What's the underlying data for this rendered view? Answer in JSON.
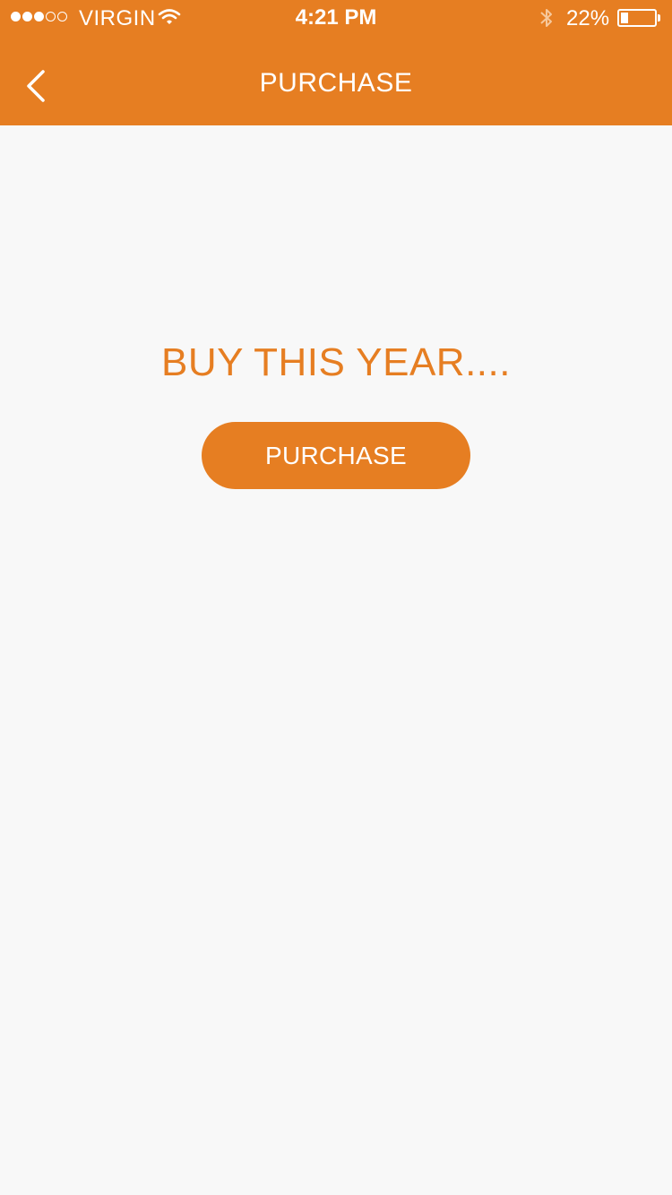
{
  "status_bar": {
    "signal_strength": 3,
    "signal_max": 5,
    "carrier": "VIRGIN",
    "time": "4:21 PM",
    "battery_percent_label": "22%",
    "battery_level": 0.22
  },
  "nav": {
    "title": "PURCHASE",
    "back_icon": "chevron-left-icon"
  },
  "main": {
    "headline": "BUY THIS YEAR....",
    "purchase_button_label": "PURCHASE"
  },
  "colors": {
    "accent": "#e67e22",
    "background": "#f8f8f8",
    "on_accent": "#ffffff"
  }
}
